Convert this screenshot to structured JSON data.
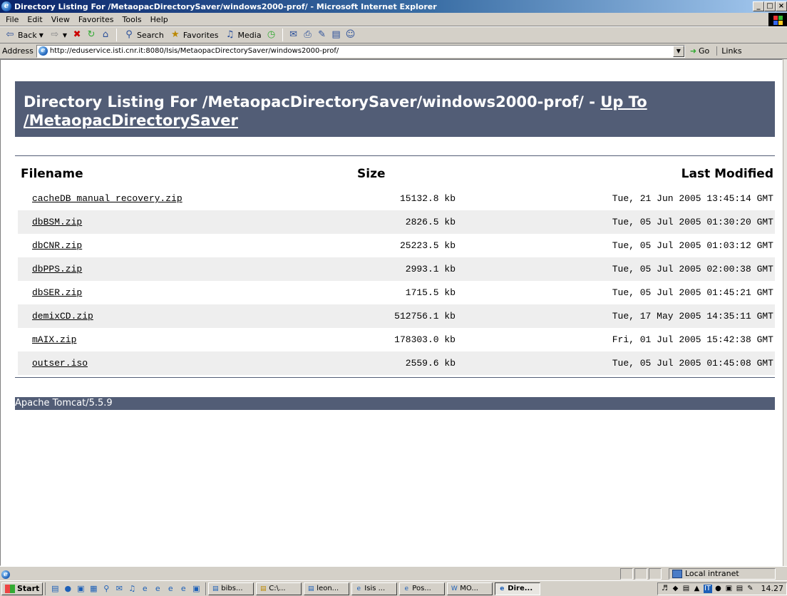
{
  "window": {
    "title": "Directory Listing For /MetaopacDirectorySaver/windows2000-prof/ - Microsoft Internet Explorer",
    "btn_min": "_",
    "btn_max": "×"
  },
  "menu": [
    "File",
    "Edit",
    "View",
    "Favorites",
    "Tools",
    "Help"
  ],
  "toolbar": {
    "back": "Back",
    "search": "Search",
    "favorites": "Favorites",
    "media": "Media"
  },
  "address": {
    "label": "Address",
    "url": "http://eduservice.isti.cnr.it:8080/Isis/MetaopacDirectorySaver/windows2000-prof/",
    "go": "Go",
    "links": "Links"
  },
  "page": {
    "heading_text": "Directory Listing For /MetaopacDirectorySaver/windows2000-prof/ - ",
    "heading_link": "Up To /MetaopacDirectorySaver",
    "columns": {
      "filename": "Filename",
      "size": "Size",
      "modified": "Last Modified"
    },
    "files": [
      {
        "name": "cacheDB_manual_recovery.zip",
        "size": "15132.8 kb",
        "modified": "Tue, 21 Jun 2005 13:45:14 GMT"
      },
      {
        "name": "dbBSM.zip",
        "size": "2826.5 kb",
        "modified": "Tue, 05 Jul 2005 01:30:20 GMT"
      },
      {
        "name": "dbCNR.zip",
        "size": "25223.5 kb",
        "modified": "Tue, 05 Jul 2005 01:03:12 GMT"
      },
      {
        "name": "dbPPS.zip",
        "size": "2993.1 kb",
        "modified": "Tue, 05 Jul 2005 02:00:38 GMT"
      },
      {
        "name": "dbSER.zip",
        "size": "1715.5 kb",
        "modified": "Tue, 05 Jul 2005 01:45:21 GMT"
      },
      {
        "name": "demixCD.zip",
        "size": "512756.1 kb",
        "modified": "Tue, 17 May 2005 14:35:11 GMT"
      },
      {
        "name": "mAIX.zip",
        "size": "178303.0 kb",
        "modified": "Fri, 01 Jul 2005 15:42:38 GMT"
      },
      {
        "name": "outser.iso",
        "size": "2559.6 kb",
        "modified": "Tue, 05 Jul 2005 01:45:08 GMT"
      }
    ],
    "footer": "Apache Tomcat/5.5.9"
  },
  "status": {
    "zone": "Local intranet"
  },
  "taskbar": {
    "start": "Start",
    "tasks": [
      "bibs...",
      "C:\\...",
      "leon...",
      "Isis ...",
      "Pos...",
      "MO...",
      "Dire..."
    ],
    "active_index": 6,
    "clock": "14.27"
  }
}
